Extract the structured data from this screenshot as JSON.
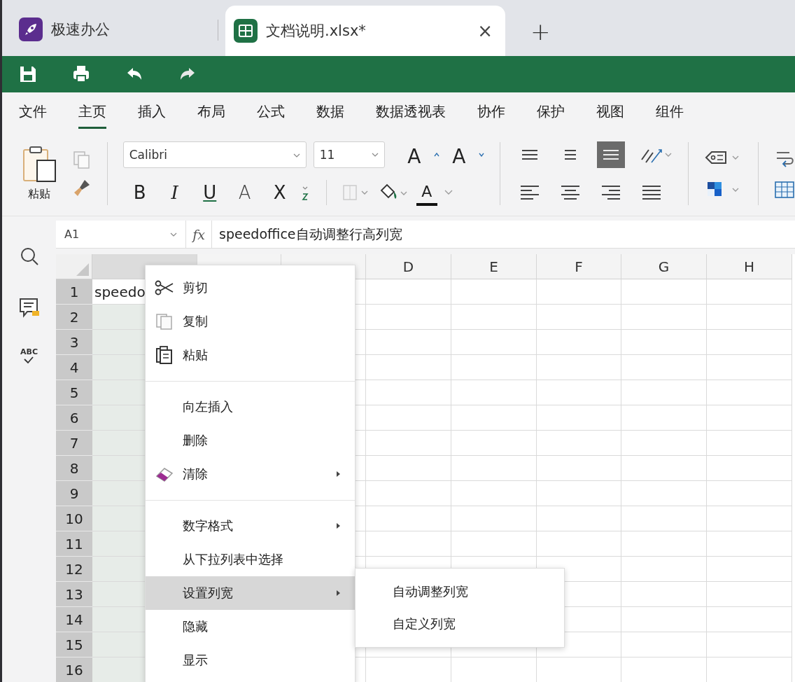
{
  "tabs": [
    {
      "kind": "app",
      "label": "极速办公",
      "selected": false
    },
    {
      "kind": "sheet",
      "label": "文档说明.xlsx*",
      "selected": true
    }
  ],
  "close_tab": "×",
  "new_tab": "+",
  "menu_tabs": [
    {
      "label": "文件",
      "selected": false
    },
    {
      "label": "主页",
      "selected": true
    },
    {
      "label": "插入",
      "selected": false
    },
    {
      "label": "布局",
      "selected": false
    },
    {
      "label": "公式",
      "selected": false
    },
    {
      "label": "数据",
      "selected": false
    },
    {
      "label": "数据透视表",
      "selected": false
    },
    {
      "label": "协作",
      "selected": false
    },
    {
      "label": "保护",
      "selected": false
    },
    {
      "label": "视图",
      "selected": false
    },
    {
      "label": "组件",
      "selected": false
    }
  ],
  "ribbon": {
    "paste_label": "粘贴",
    "font": "Calibri",
    "size": "11",
    "grow": "A",
    "shrink": "A",
    "font_color": "A",
    "format_buttons": [
      {
        "kind": "bold",
        "label": "B"
      },
      {
        "kind": "italic",
        "label": "I"
      },
      {
        "kind": "underline",
        "label": "U"
      },
      {
        "kind": "strike",
        "label": "A"
      },
      {
        "kind": "subscript",
        "label": "X"
      }
    ],
    "vertical_align": [
      {
        "kind": "top",
        "selected": false
      },
      {
        "kind": "middle",
        "selected": false
      },
      {
        "kind": "bottom",
        "selected": true
      }
    ],
    "horizontal_align": [
      {
        "kind": "left",
        "selected": false
      },
      {
        "kind": "center",
        "selected": false
      },
      {
        "kind": "right",
        "selected": false
      },
      {
        "kind": "justify",
        "selected": false
      }
    ]
  },
  "sidebar": {
    "spellcheck_label": "ABC"
  },
  "formula_bar": {
    "name_box": "A1",
    "fx": "fx",
    "formula": "speedoffice自动调整行高列宽"
  },
  "sheet": {
    "columns": [
      {
        "selected": true
      },
      {
        "selected": false
      },
      {
        "selected": false
      },
      {
        "label": "D",
        "selected": false
      },
      {
        "label": "E",
        "selected": false
      },
      {
        "label": "F",
        "selected": false
      },
      {
        "label": "G",
        "selected": false
      },
      {
        "label": "H",
        "selected": false
      }
    ],
    "rows": [
      {
        "label": "1",
        "selected": true,
        "cells": [
          "speedo"
        ]
      },
      {
        "label": "2",
        "selected": true
      },
      {
        "label": "3",
        "selected": true
      },
      {
        "label": "4",
        "selected": true
      },
      {
        "label": "5",
        "selected": true
      },
      {
        "label": "6",
        "selected": true
      },
      {
        "label": "7",
        "selected": true
      },
      {
        "label": "8",
        "selected": true
      },
      {
        "label": "9",
        "selected": true
      },
      {
        "label": "10",
        "selected": true
      },
      {
        "label": "11",
        "selected": true
      },
      {
        "label": "12",
        "selected": true
      },
      {
        "label": "13",
        "selected": true
      },
      {
        "label": "14",
        "selected": true
      },
      {
        "label": "15",
        "selected": true
      },
      {
        "label": "16",
        "selected": true
      }
    ]
  },
  "context_menu": [
    {
      "kind": "cut",
      "label": "剪切",
      "submenu": false,
      "selected": false
    },
    {
      "kind": "copy",
      "label": "复制",
      "submenu": false,
      "selected": false
    },
    {
      "kind": "paste",
      "label": "粘贴",
      "submenu": false,
      "selected": false
    },
    {
      "kind": "separator"
    },
    {
      "kind": "plain",
      "label": "向左插入",
      "submenu": false,
      "selected": false
    },
    {
      "kind": "plain",
      "label": "删除",
      "submenu": false,
      "selected": false
    },
    {
      "kind": "clear",
      "label": "清除",
      "submenu": true,
      "selected": false
    },
    {
      "kind": "separator"
    },
    {
      "kind": "plain",
      "label": "数字格式",
      "submenu": true,
      "selected": false
    },
    {
      "kind": "plain",
      "label": "从下拉列表中选择",
      "submenu": false,
      "selected": false
    },
    {
      "kind": "plain",
      "label": "设置列宽",
      "submenu": true,
      "selected": true
    },
    {
      "kind": "plain",
      "label": "隐藏",
      "submenu": false,
      "selected": false
    },
    {
      "kind": "plain",
      "label": "显示",
      "submenu": false,
      "selected": false
    }
  ],
  "submenu": [
    {
      "label": "自动调整列宽",
      "selected": false
    },
    {
      "label": "自定义列宽",
      "selected": false
    }
  ]
}
